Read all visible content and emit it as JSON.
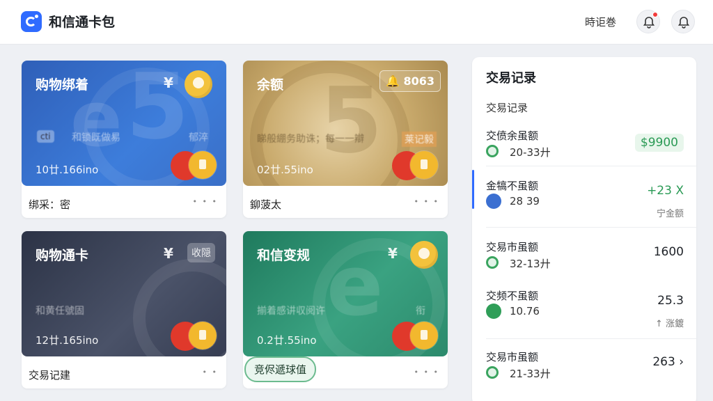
{
  "header": {
    "app_title": "和信通卡包",
    "link_label": "時讵巻",
    "icons": [
      "bell-icon",
      "notification-icon"
    ]
  },
  "cards": [
    {
      "title": "购物绑着",
      "symbol": "¥",
      "line1": "和锁既做易",
      "line2": "郁淬",
      "chip": "cti",
      "number": "10廿.166ino",
      "footer": "绑采：密",
      "more": "• • •",
      "color": "#3b6fd1"
    },
    {
      "title": "余额",
      "badge": "8063",
      "line1": "睇般綳务助诛；每一一辯",
      "line2": "莱记毅",
      "number": "02廿.55ino",
      "footer": "鉚菠太",
      "more": "• • •",
      "color": "#c9a86a"
    },
    {
      "title": "购物通卡",
      "symbol": "¥",
      "tag": "收隠",
      "line1": "和黄任號固",
      "number": "12廿.165ino",
      "footer": "交易记建",
      "more": "• •",
      "color": "#3c4458"
    },
    {
      "title": "和信变规",
      "symbol": "¥",
      "line1": "揃着感讲収阅许",
      "line2": "衔",
      "number": "0.2廿.55ino",
      "footer": "竞侭遞球值",
      "more": "• • •",
      "color": "#2f8a6c"
    }
  ],
  "panel": {
    "title": "交易记录",
    "subtitle": "交易记录",
    "transactions": [
      {
        "name": "交偾余虽额",
        "date": "20-33廾",
        "amount": "$9900",
        "amount_color": "#2a9a55",
        "icon_color": "#3aa45f"
      },
      {
        "name": "金犒不虽额",
        "date": "28 39",
        "amount": "+23 X",
        "amount_color": "#2a9a55",
        "note": "宁金额",
        "icon_color": "#3b6fd1"
      },
      {
        "name": "交易市虽额",
        "date": "32-13廾",
        "amount": "1600",
        "amount_color": "#1f2329",
        "icon_color": "#3aa45f"
      },
      {
        "name": "交频不虽额",
        "date": "10.76",
        "amount": "25.3",
        "amount_color": "#1f2329",
        "note": "↑ 涨鍍",
        "icon_color": "#2f9e58"
      },
      {
        "name": "交易市虽额",
        "date": "21-33廾",
        "amount": "263 ›",
        "amount_color": "#1f2329",
        "icon_color": "#3aa45f"
      }
    ]
  }
}
